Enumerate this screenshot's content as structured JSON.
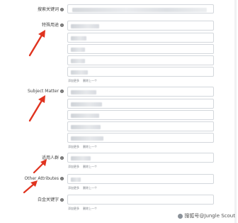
{
  "labels": {
    "search_terms": "搜索关键词",
    "intended_use": "特殊用途",
    "subject_matter": "Subject Matter",
    "target_audience": "适用人群",
    "other_attributes": "Other Attributes",
    "platinum_keywords": "白金关键字"
  },
  "field_controls": {
    "add_more": "添加更多",
    "remove_last": "删除上一个"
  },
  "watermark": "搜狐号@Jungle Scout",
  "colors": {
    "arrow": "#e0331f",
    "field_border": "#d3d7dc",
    "label_text": "#444444"
  }
}
